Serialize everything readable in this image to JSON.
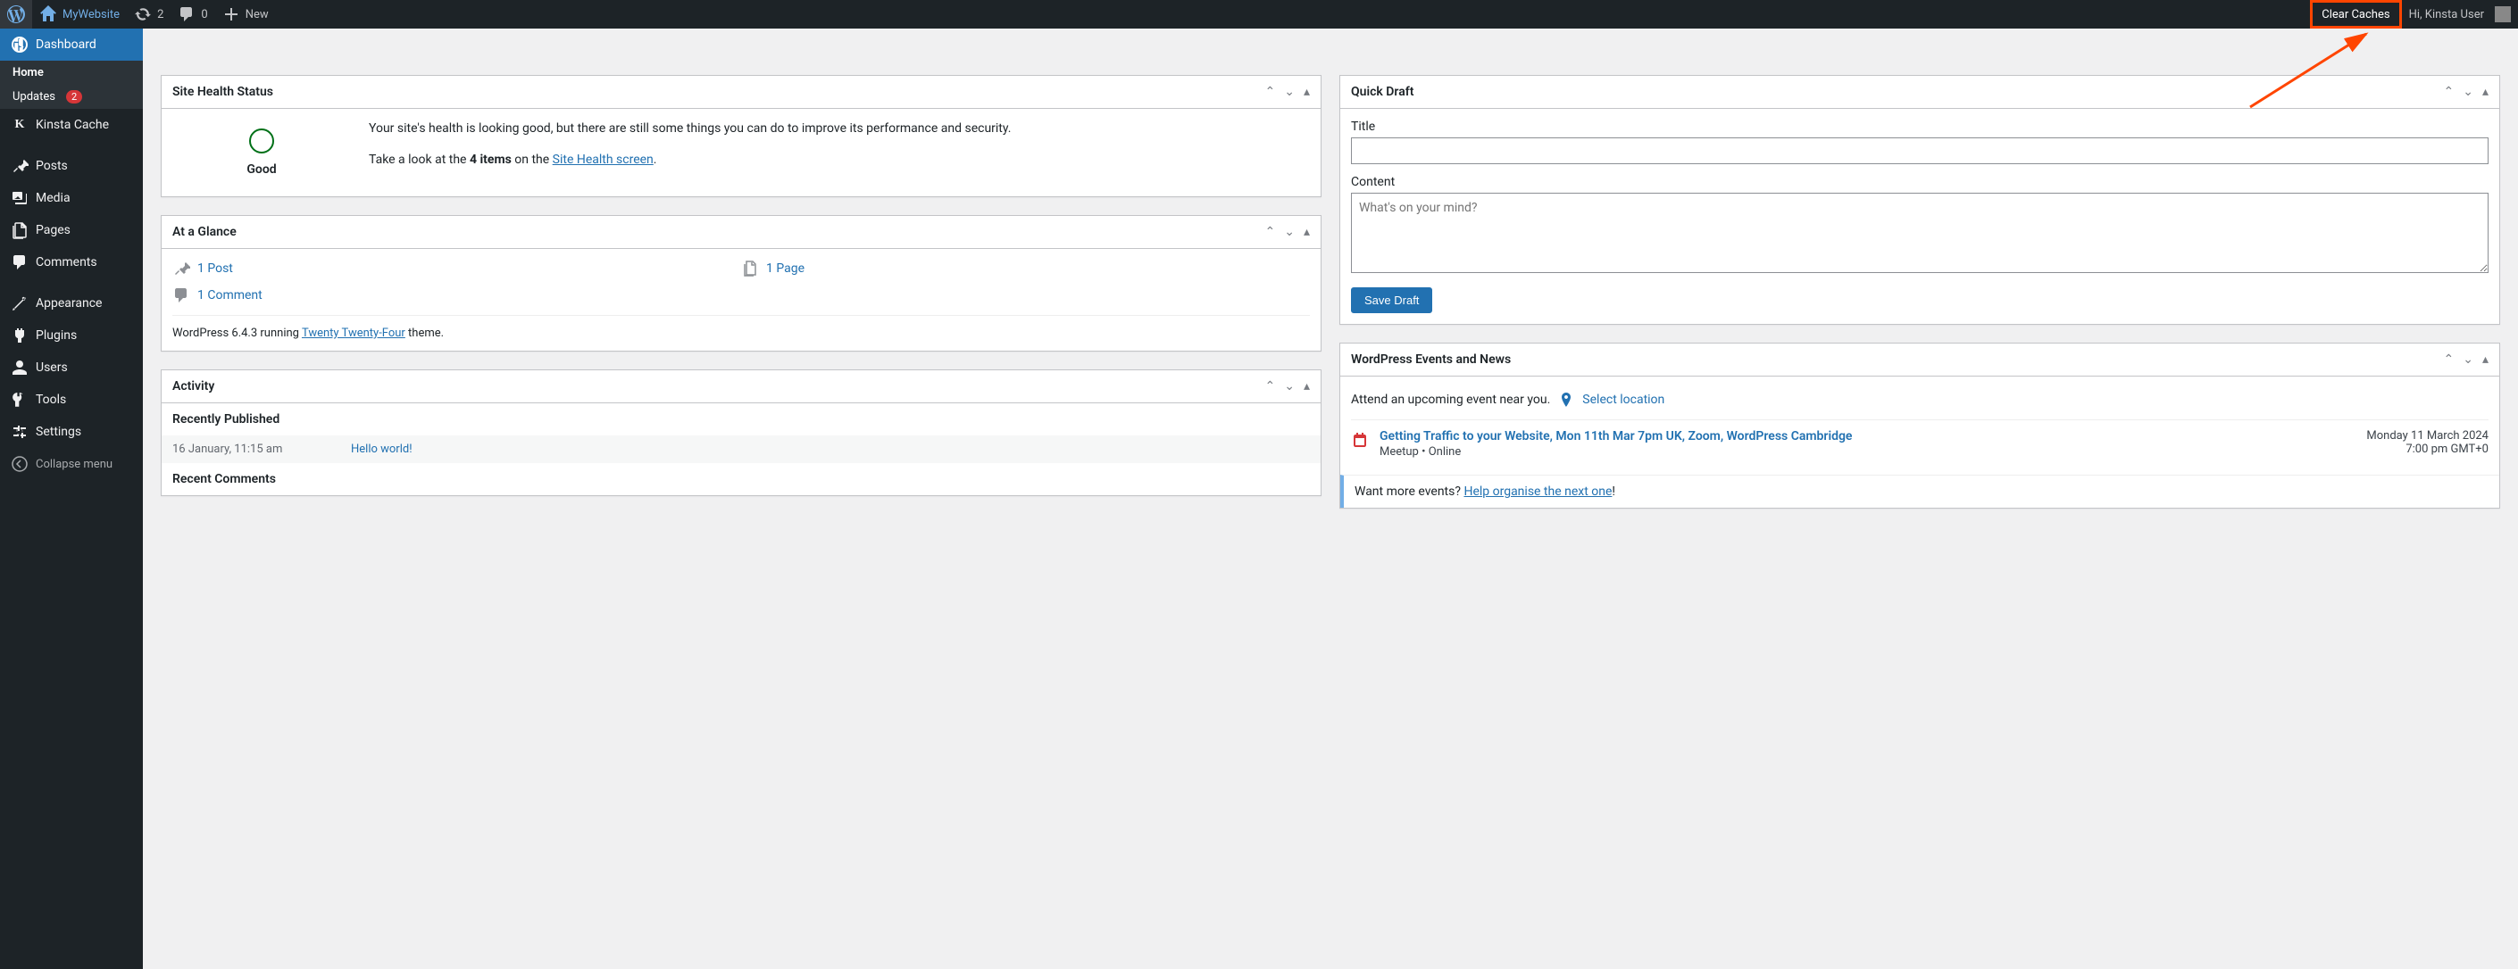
{
  "adminbar": {
    "site_name": "MyWebsite",
    "refresh_count": "2",
    "comments_count": "0",
    "new_label": "New",
    "clear_caches": "Clear Caches",
    "howdy": "Hi, Kinsta User"
  },
  "sidebar": {
    "dashboard": "Dashboard",
    "home": "Home",
    "updates": "Updates",
    "updates_count": "2",
    "kinsta_cache": "Kinsta Cache",
    "posts": "Posts",
    "media": "Media",
    "pages": "Pages",
    "comments": "Comments",
    "appearance": "Appearance",
    "plugins": "Plugins",
    "users": "Users",
    "tools": "Tools",
    "settings": "Settings",
    "collapse": "Collapse menu"
  },
  "site_health": {
    "title": "Site Health Status",
    "status_label": "Good",
    "text": "Your site's health is looking good, but there are still some things you can do to improve its performance and security.",
    "text2_prefix": "Take a look at the ",
    "text2_bold": "4 items",
    "text2_mid": " on the ",
    "text2_link": "Site Health screen",
    "text2_suffix": "."
  },
  "glance": {
    "title": "At a Glance",
    "posts": "1 Post",
    "pages": "1 Page",
    "comments": "1 Comment",
    "footer_prefix": "WordPress 6.4.3 running ",
    "theme_link": "Twenty Twenty-Four",
    "footer_suffix": " theme."
  },
  "activity": {
    "title": "Activity",
    "recently_published": "Recently Published",
    "post_date": "16 January, 11:15 am",
    "post_title": "Hello world!",
    "recent_comments": "Recent Comments"
  },
  "quick_draft": {
    "title": "Quick Draft",
    "title_label": "Title",
    "content_label": "Content",
    "content_placeholder": "What's on your mind?",
    "save_button": "Save Draft"
  },
  "events": {
    "title": "WordPress Events and News",
    "intro": "Attend an upcoming event near you.",
    "select_location": "Select location",
    "event1_title": "Getting Traffic to your Website, Mon 11th Mar 7pm UK, Zoom, WordPress Cambridge",
    "event1_meta": "Meetup • Online",
    "event1_date": "Monday 11 March 2024",
    "event1_time": "7:00 pm GMT+0",
    "more_prefix": "Want more events? ",
    "more_link": "Help organise the next one",
    "more_suffix": "!"
  }
}
